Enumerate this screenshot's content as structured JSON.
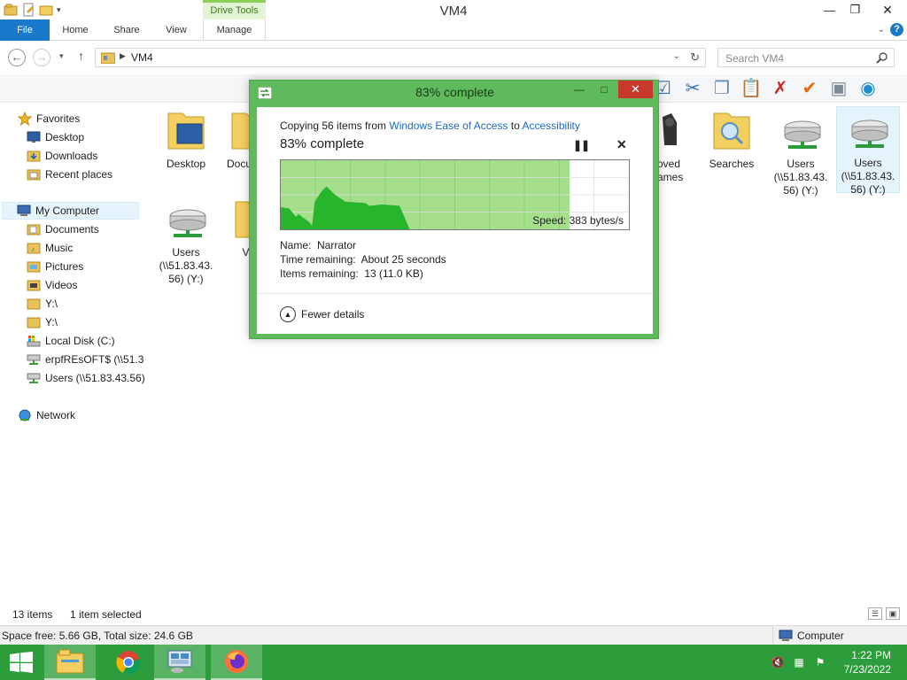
{
  "window": {
    "title": "VM4",
    "context_tab_label": "Drive Tools"
  },
  "ribbon": {
    "tabs": [
      "File",
      "Home",
      "Share",
      "View",
      "Manage"
    ]
  },
  "address": {
    "path": "VM4",
    "search_placeholder": "Search VM4"
  },
  "nav": {
    "items": [
      {
        "label": "Favorites",
        "icon": "star-icon"
      },
      {
        "label": "Desktop",
        "icon": "desktop-icon"
      },
      {
        "label": "Downloads",
        "icon": "downloads-icon"
      },
      {
        "label": "Recent places",
        "icon": "recent-places-icon"
      },
      {
        "label": "My Computer",
        "icon": "computer-icon"
      },
      {
        "label": "Documents",
        "icon": "documents-icon"
      },
      {
        "label": "Music",
        "icon": "music-icon"
      },
      {
        "label": "Pictures",
        "icon": "pictures-icon"
      },
      {
        "label": "Videos",
        "icon": "videos-icon"
      },
      {
        "label": "Y:\\",
        "icon": "folder-icon"
      },
      {
        "label": "Y:\\",
        "icon": "folder-icon"
      },
      {
        "label": "Local Disk (C:)",
        "icon": "local-disk-icon"
      },
      {
        "label": "erpfREsOFT$ (\\\\51.3",
        "icon": "network-drive-icon"
      },
      {
        "label": "Users (\\\\51.83.43.56)",
        "icon": "network-drive-icon"
      },
      {
        "label": "Network",
        "icon": "network-icon"
      }
    ]
  },
  "content": {
    "items": [
      {
        "label": "Desktop",
        "icon": "desktop-folder-icon"
      },
      {
        "label": "Docu",
        "icon": "folder-icon"
      },
      {
        "label": "oved\names",
        "icon": "saved-games-icon"
      },
      {
        "label": "Searches",
        "icon": "searches-folder-icon"
      },
      {
        "label": "Users\n(\\\\51.83.43.\n56) (Y:)",
        "icon": "network-drive-icon"
      },
      {
        "label": "Users\n(\\\\51.83.43.\n56) (Y:)",
        "icon": "network-drive-icon"
      },
      {
        "label": "Users\n(\\\\51.83.43.\n56) (Y:)",
        "icon": "network-drive-icon"
      },
      {
        "label": "Vi",
        "icon": "folder-icon"
      }
    ]
  },
  "dialog": {
    "title": "83% complete",
    "copying_prefix": "Copying 56 items from ",
    "source": "Windows Ease of Access",
    "to_word": " to ",
    "destination": "Accessibility",
    "percent_text": "83% complete",
    "progress": 0.83,
    "speed_label": "Speed:",
    "speed_value": "383 bytes/s",
    "name_label": "Name:",
    "name_value": "Narrator",
    "time_label": "Time remaining:",
    "time_value": "About 25 seconds",
    "items_label": "Items remaining:",
    "items_value": "13 (11.0 KB)",
    "fewer_details": "Fewer details",
    "colors": {
      "fill": "#27b52c",
      "bg_done": "#a5df8c",
      "frame": "#5fb95d",
      "close": "#c7392b"
    }
  },
  "status": {
    "item_count": "13 items",
    "selected": "1 item selected",
    "space": "Space free: 5.66 GB, Total size: 24.6 GB",
    "location": "Computer"
  },
  "taskbar": {
    "time": "1:22 PM",
    "date": "7/23/2022",
    "color": "#2c9d3a"
  }
}
